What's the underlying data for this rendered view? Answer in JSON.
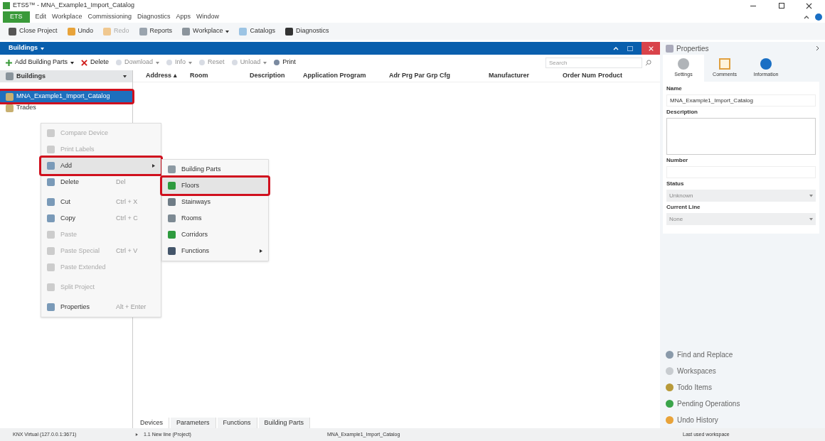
{
  "window": {
    "title": "ETS5™ - MNA_Example1_Import_Catalog"
  },
  "menu_bar": [
    {
      "label": "ETS",
      "selected": true
    },
    {
      "label": "Edit",
      "selected": false
    },
    {
      "label": "Workplace",
      "selected": false
    },
    {
      "label": "Commissioning",
      "selected": false
    },
    {
      "label": "Diagnostics",
      "selected": false
    },
    {
      "label": "Apps",
      "selected": false
    },
    {
      "label": "Window",
      "selected": false
    }
  ],
  "toolbar": [
    {
      "label": "Close Project",
      "disabled": false,
      "dropdown": false
    },
    {
      "label": "Undo",
      "disabled": false,
      "dropdown": false
    },
    {
      "label": "Redo",
      "disabled": true,
      "dropdown": false
    },
    {
      "label": "Reports",
      "disabled": false,
      "dropdown": false
    },
    {
      "label": "Workplace",
      "disabled": false,
      "dropdown": true
    },
    {
      "label": "Catalogs",
      "disabled": false,
      "dropdown": false
    },
    {
      "label": "Diagnostics",
      "disabled": false,
      "dropdown": false
    }
  ],
  "panel": {
    "title": "Buildings",
    "toolbar": [
      {
        "label": "Add Building Parts",
        "disabled": false,
        "dropdown": true
      },
      {
        "label": "Delete",
        "disabled": false,
        "dropdown": false
      },
      {
        "label": "Download",
        "disabled": true,
        "dropdown": true
      },
      {
        "label": "Info",
        "disabled": true,
        "dropdown": true
      },
      {
        "label": "Reset",
        "disabled": true,
        "dropdown": false
      },
      {
        "label": "Unload",
        "disabled": true,
        "dropdown": true
      },
      {
        "label": "Print",
        "disabled": false,
        "dropdown": false
      }
    ],
    "search": {
      "placeholder": "Search"
    },
    "tree_header": "Buildings",
    "tree": [
      {
        "label": "MNA_Example1_Import_Catalog",
        "selected": true,
        "highlighted": true
      },
      {
        "label": "Trades",
        "selected": false,
        "highlighted": false
      }
    ],
    "columns": [
      "Address ▴",
      "Room",
      "Description",
      "Application Program",
      "Adr Prg Par Grp Cfg",
      "Manufacturer",
      "Order Num",
      "Product"
    ],
    "bottom_tabs": [
      {
        "label": "Devices",
        "selected": true
      },
      {
        "label": "Parameters",
        "selected": false
      },
      {
        "label": "Functions",
        "selected": false
      },
      {
        "label": "Building Parts",
        "selected": false
      }
    ]
  },
  "context_menu": [
    {
      "label": "Compare Device",
      "disabled": true,
      "highlighted": false,
      "submenu": false
    },
    {
      "label": "Print Labels",
      "disabled": true,
      "highlighted": false,
      "submenu": false
    },
    {
      "label": "Add",
      "disabled": false,
      "highlighted": true,
      "submenu": true
    },
    {
      "label": "Delete",
      "shortcut": "Del",
      "disabled": false,
      "highlighted": false,
      "submenu": false
    },
    {
      "label": "Cut",
      "shortcut": "Ctrl + X",
      "disabled": false,
      "highlighted": false,
      "submenu": false
    },
    {
      "label": "Copy",
      "shortcut": "Ctrl + C",
      "disabled": false,
      "highlighted": false,
      "submenu": false
    },
    {
      "label": "Paste",
      "disabled": true,
      "highlighted": false,
      "submenu": false
    },
    {
      "label": "Paste Special",
      "shortcut": "Ctrl + V",
      "disabled": true,
      "highlighted": false,
      "submenu": false
    },
    {
      "label": "Paste Extended",
      "disabled": true,
      "highlighted": false,
      "submenu": false
    },
    {
      "label": "Split Project",
      "disabled": true,
      "highlighted": false,
      "submenu": false
    },
    {
      "label": "Properties",
      "shortcut": "Alt + Enter",
      "disabled": false,
      "highlighted": false,
      "submenu": false
    }
  ],
  "submenu": [
    {
      "label": "Building Parts",
      "highlighted": false,
      "submenu": false
    },
    {
      "label": "Floors",
      "highlighted": true,
      "submenu": false
    },
    {
      "label": "Stainways",
      "highlighted": false,
      "submenu": false
    },
    {
      "label": "Rooms",
      "highlighted": false,
      "submenu": false
    },
    {
      "label": "Corridors",
      "highlighted": false,
      "submenu": false
    },
    {
      "label": "Functions",
      "highlighted": false,
      "submenu": true
    }
  ],
  "properties": {
    "title": "Properties",
    "tabs": [
      {
        "label": "Settings",
        "selected": true
      },
      {
        "label": "Comments",
        "selected": false
      },
      {
        "label": "Information",
        "selected": false
      }
    ],
    "fields": [
      {
        "label": "Name",
        "kind": "text",
        "value": "MNA_Example1_Import_Catalog"
      },
      {
        "label": "Description",
        "kind": "textarea"
      },
      {
        "label": "Number",
        "kind": "text"
      },
      {
        "label": "Status",
        "kind": "select",
        "value": "Unknown"
      },
      {
        "label": "Current Line",
        "kind": "select",
        "value": "None"
      }
    ],
    "links": [
      "Find and Replace",
      "Workspaces",
      "Todo Items",
      "Pending Operations",
      "Undo History"
    ]
  },
  "status_bar": {
    "connection": "KNX Virtual  (127.0.0.1:3671)",
    "line": "1.1 New line (Project)",
    "project": "MNA_Example1_Import_Catalog",
    "workspace": "Last used workspace"
  }
}
